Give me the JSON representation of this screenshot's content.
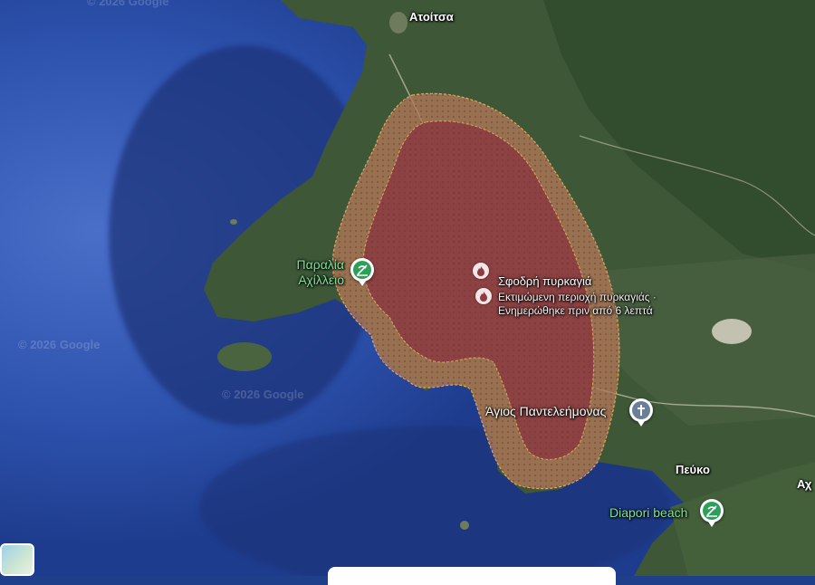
{
  "map": {
    "colors": {
      "deep_sea": "#1d3a86",
      "shallow_sea": "#2a52a8",
      "land": "#3f5a3a",
      "fire_outer": "#b5795a",
      "fire_inner": "#8e3b42"
    },
    "watermarks": [
      "© 2026 Google",
      "© 2026 Google",
      "© 2026 Google"
    ]
  },
  "places": {
    "atoitsa": "Ατοίτσα",
    "peuko": "Πεύκο",
    "ach_partial": "Αχ"
  },
  "pois": {
    "achilleio_line1": "Παραλία",
    "achilleio_line2": "Αχίλλειο",
    "diapori": "Diapori beach",
    "church": "Άγιος Παντελεήμονας"
  },
  "fire": {
    "title": "Σφοδρή πυρκαγιά",
    "sub_line1": "Εκτιμώμενη περιοχή πυρκαγιάς ·",
    "sub_line2": "Ενημερώθηκε πριν από 6 λεπτά"
  },
  "icons": {
    "beach": "beach-icon",
    "church": "church-cross-icon",
    "fire": "fire-icon"
  }
}
